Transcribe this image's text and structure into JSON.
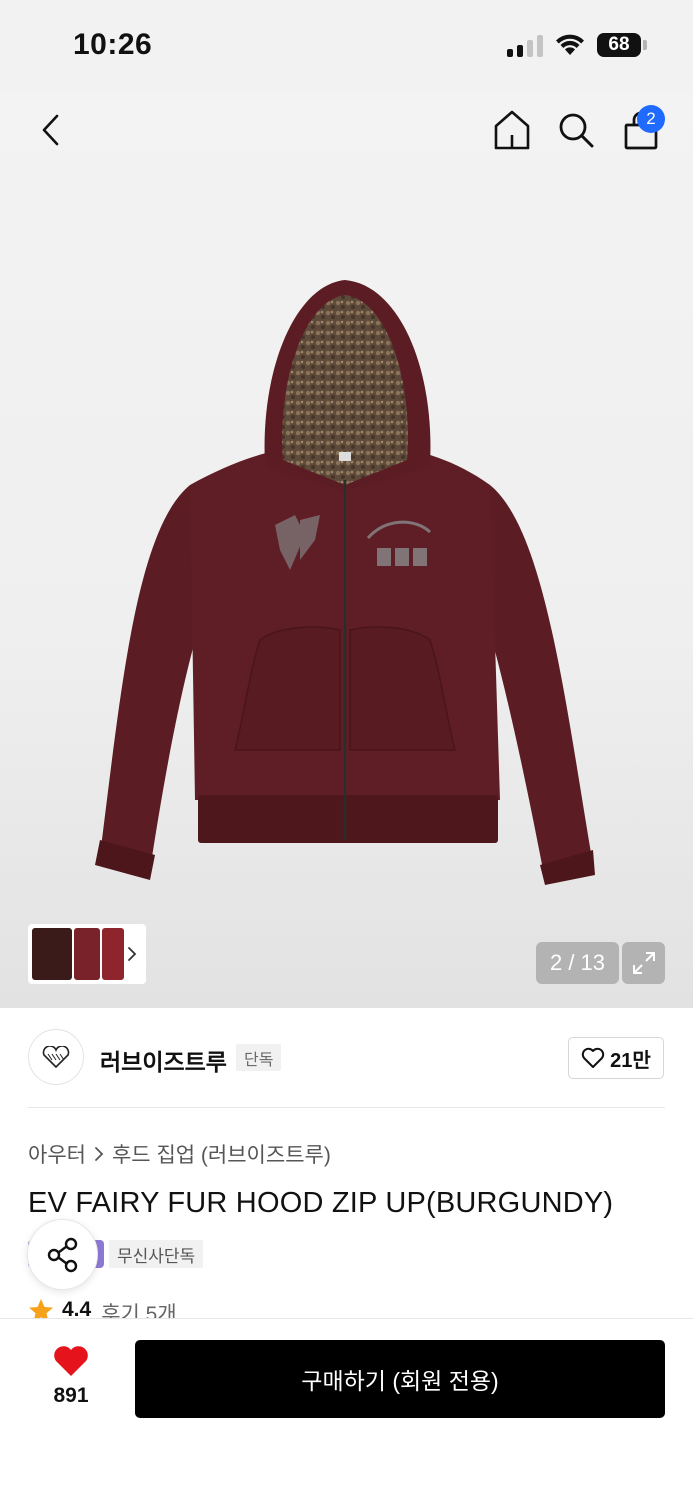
{
  "status_bar": {
    "time": "10:26",
    "battery": "68"
  },
  "header": {
    "cart_count": "2"
  },
  "gallery": {
    "counter": "2 / 13"
  },
  "brand": {
    "name": "러브이즈트루",
    "tag": "단독",
    "likes": "21만"
  },
  "product": {
    "breadcrumb": [
      "아우터",
      "후드 집업 (러브이즈트루)"
    ],
    "title": "EV FAIRY FUR HOOD ZIP UP(BURGUNDY)",
    "exclusive_tag": "무신사단독",
    "rating": "4.4",
    "review_label": "후기 5개"
  },
  "bottom_bar": {
    "wish_count": "891",
    "buy_label": "구매하기 (회원 전용)"
  },
  "colors": {
    "accent_blue": "#1f6bff",
    "burgundy": "#5a1c22",
    "heart_red": "#e5141c",
    "badge_purple": "#8e7ad6"
  }
}
